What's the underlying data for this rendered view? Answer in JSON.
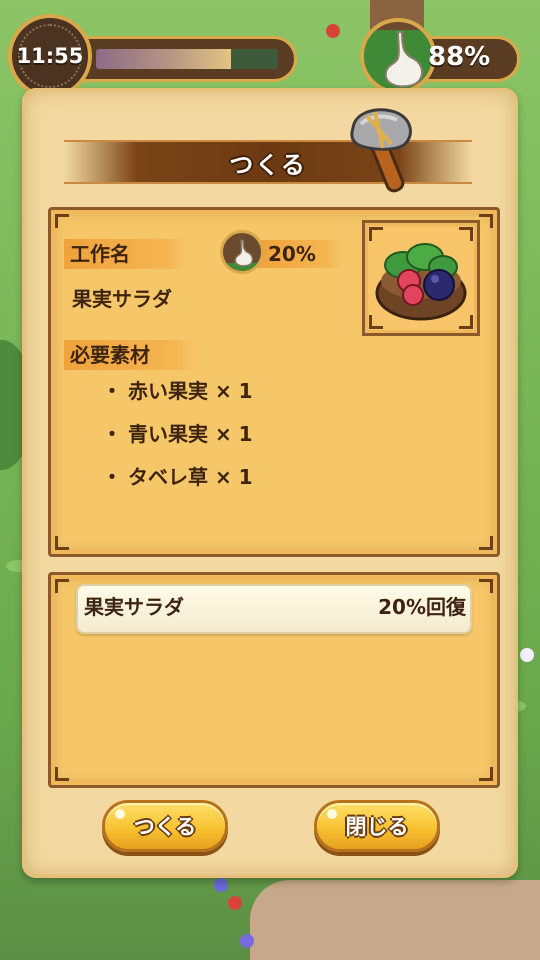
{
  "hud": {
    "time": "11:55",
    "time_progress": 0.74,
    "hunger_percent": "88%",
    "hunger_level": 0.88
  },
  "dialog": {
    "title": "つくる",
    "craft_name_label": "工作名",
    "recovery_percent": "20%",
    "item_name": "果実サラダ",
    "materials_label": "必要素材",
    "materials": [
      "赤い果実 × 1",
      "青い果実 × 1",
      "タベレ草 × 1"
    ],
    "result": {
      "name": "果実サラダ",
      "effect": "20%回復"
    },
    "buttons": {
      "craft": "つくる",
      "close": "閉じる"
    }
  },
  "colors": {
    "parchment": "#f3d9a1",
    "panel": "#f6c769",
    "button": "#f7c232",
    "hunger_green": "#3e8a36",
    "text_brown": "#3d2410"
  }
}
